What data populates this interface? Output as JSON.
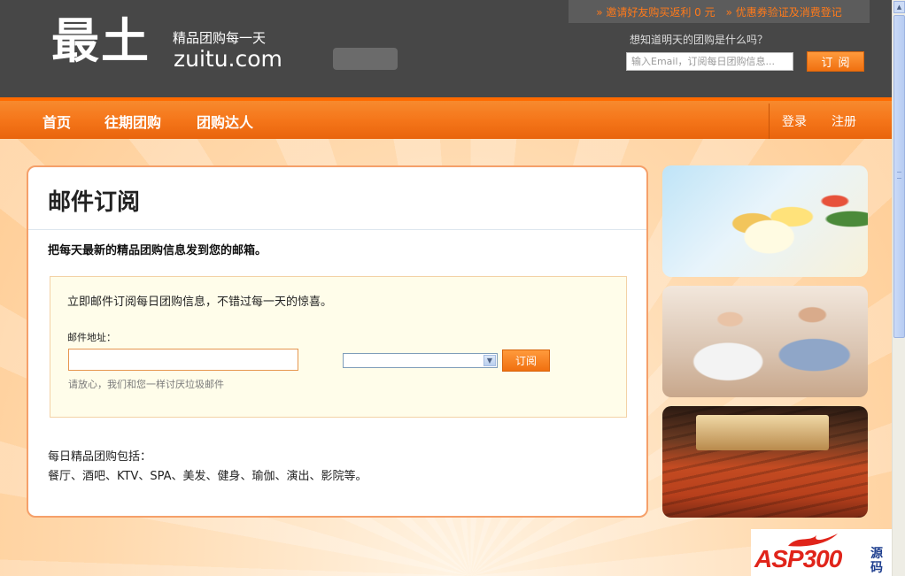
{
  "header": {
    "logo": "最土",
    "slogan": "精品团购每一天",
    "domain": "zuitu.com",
    "promo_links": [
      "» 邀请好友购买返利 0 元",
      "» 优惠券验证及消费登记"
    ],
    "subscribe_question": "想知道明天的团购是什么吗？",
    "subscribe_placeholder": "输入Email，订阅每日团购信息...",
    "subscribe_button": "订阅"
  },
  "nav": {
    "items": [
      "首页",
      "往期团购",
      "团购达人"
    ],
    "login": "登录",
    "register": "注册"
  },
  "main": {
    "title": "邮件订阅",
    "lead": "把每天最新的精品团购信息发到您的邮箱。",
    "form": {
      "intro": "立即邮件订阅每日团购信息，不错过每一天的惊喜。",
      "email_label": "邮件地址：",
      "email_value": "",
      "city_selected": "",
      "submit": "订阅",
      "note": "请放心，我们和您一样讨厌垃圾邮件"
    },
    "includes_title": "每日精品团购包括：",
    "includes_list": "餐厅、酒吧、KTV、SPA、美发、健身、瑜伽、演出、影院等。"
  },
  "watermark": {
    "brand": "ASP300",
    "suffix": "源码"
  }
}
